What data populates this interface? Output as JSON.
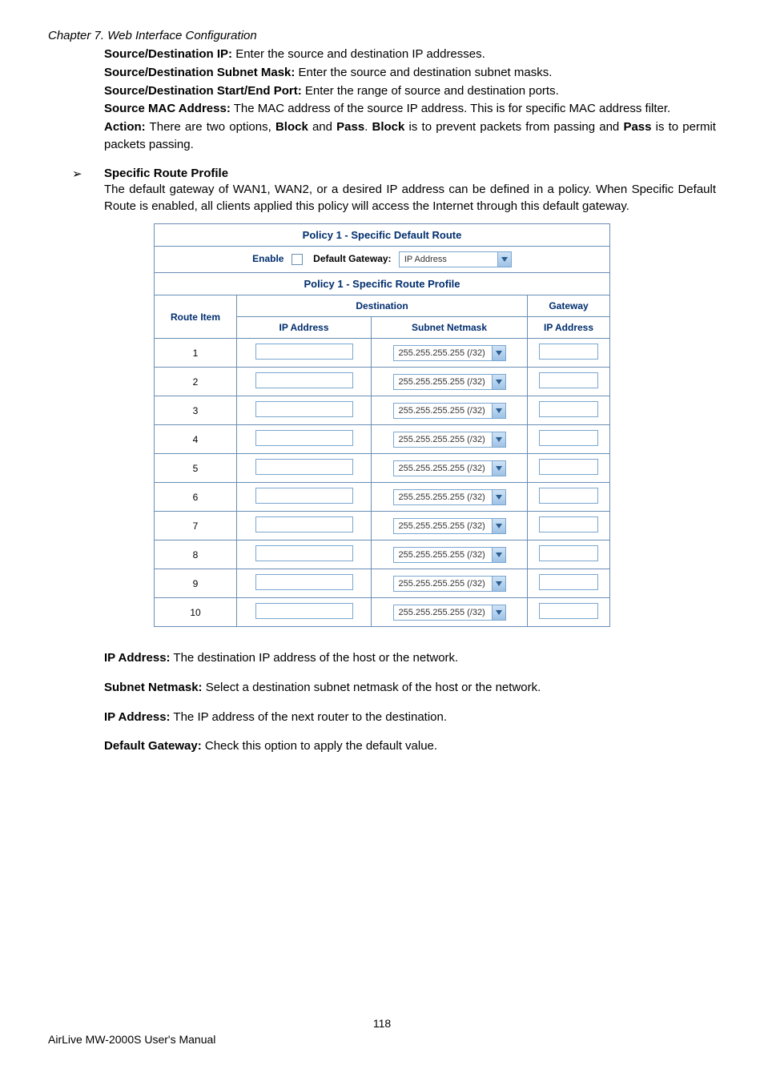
{
  "chapter": "Chapter 7.    Web Interface Configuration",
  "intro": {
    "l1b": "Source/Destination IP:",
    "l1t": " Enter the source and destination IP addresses.",
    "l2b": "Source/Destination Subnet Mask:",
    "l2t": " Enter the source and destination subnet masks.",
    "l3b": "Source/Destination Start/End Port:",
    "l3t": " Enter the range of source and destination ports.",
    "l4b": "Source MAC Address:",
    "l4t": " The MAC address of the source IP address. This is for specific MAC address filter.",
    "l5b1": "Action:",
    "l5t1": " There are two options, ",
    "l5b2": "Block",
    "l5t2": " and ",
    "l5b3": "Pass",
    "l5t3": ". ",
    "l5b4": "Block",
    "l5t4": " is to prevent packets from passing and ",
    "l5b5": "Pass",
    "l5t5": " is to permit packets passing."
  },
  "arrow": "➢",
  "section_title": "Specific Route Profile",
  "section_body": "The default gateway of WAN1, WAN2, or a desired IP address can be defined in a policy. When Specific Default Route is enabled, all clients applied this policy will access the Internet through this default gateway.",
  "table": {
    "hdr1": "Policy 1 - Specific Default Route",
    "enable": "Enable",
    "dg_label": "Default Gateway:",
    "dg_value": "IP Address",
    "hdr2": "Policy 1 - Specific Route Profile",
    "route_item": "Route Item",
    "destination": "Destination",
    "gateway": "Gateway",
    "ip_address": "IP Address",
    "subnet_netmask": "Subnet Netmask",
    "mask": "255.255.255.255 (/32)",
    "rows": [
      "1",
      "2",
      "3",
      "4",
      "5",
      "6",
      "7",
      "8",
      "9",
      "10"
    ]
  },
  "lower": {
    "l1b": "IP Address:",
    "l1t": " The destination IP address of the host or the network.",
    "l2b": "Subnet Netmask:",
    "l2t": " Select a destination subnet netmask of the host or the network.",
    "l3b": "IP Address:",
    "l3t": " The IP address of the next router to the destination.",
    "l4b": "Default Gateway:",
    "l4t": " Check this option to apply the default value."
  },
  "pagenum": "118",
  "manual": "AirLive MW-2000S User's Manual"
}
